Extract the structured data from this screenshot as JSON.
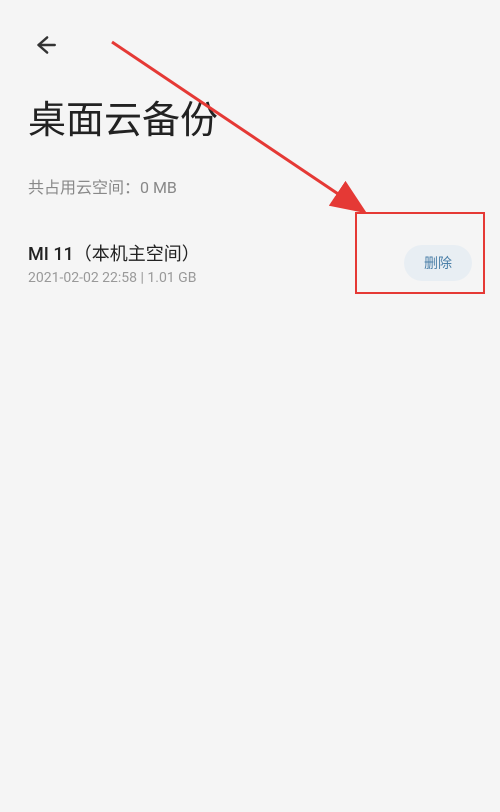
{
  "header": {
    "title": "桌面云备份",
    "storage_label": "共占用云空间：0 MB"
  },
  "backup": {
    "name": "MI 11（本机主空间）",
    "meta": "2021-02-02 22:58 | 1.01 GB",
    "delete_label": "删除"
  }
}
